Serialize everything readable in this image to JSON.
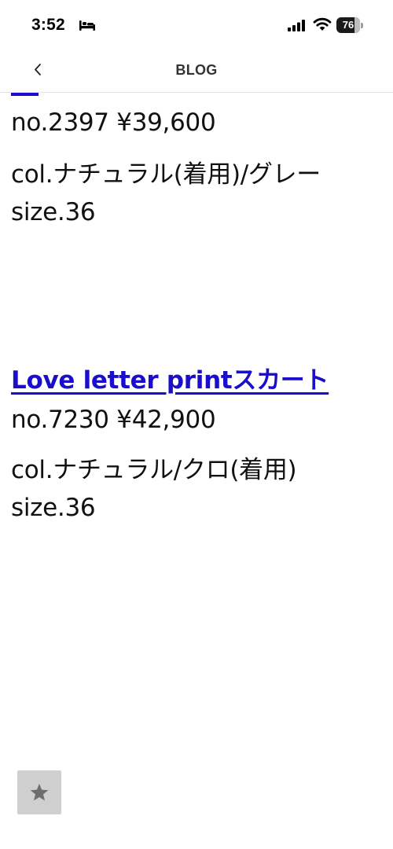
{
  "status_bar": {
    "time": "3:52",
    "battery_level": "76",
    "battery_fraction": 0.76
  },
  "nav": {
    "back_icon": "chevron-left-icon",
    "title": "BLOG"
  },
  "items": [
    {
      "price_line": "no.2397 ¥39,600",
      "color_line": "col.ナチュラル(着用)/グレー",
      "size_line": "size.36"
    },
    {
      "link_text": "Love letter printスカート",
      "price_line": "no.7230 ¥42,900",
      "color_line": "col.ナチュラル/クロ(着用)",
      "size_line": "size.36"
    }
  ],
  "favorite": {
    "icon": "star-icon"
  },
  "colors": {
    "link": "#1a0dcc",
    "favorite_bg": "#cfcfcf",
    "star": "#6d6d6d"
  }
}
